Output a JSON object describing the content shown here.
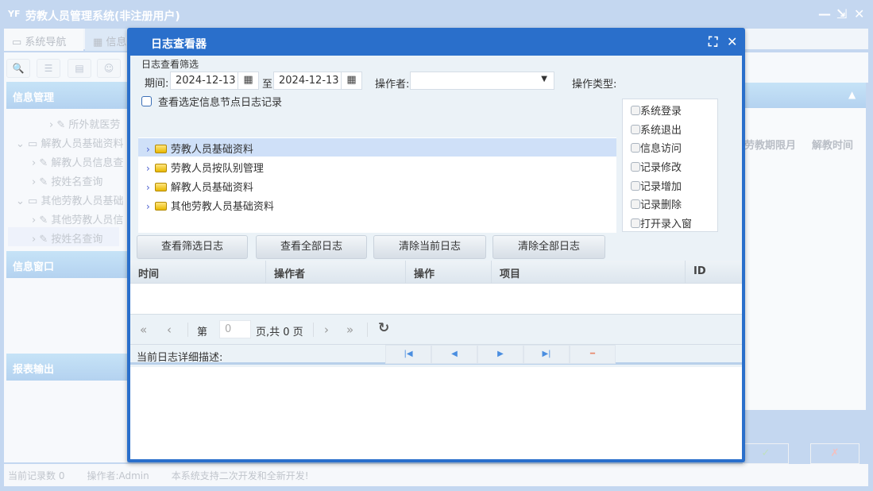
{
  "app": {
    "title": "劳教人员管理系统(非注册用户)",
    "logo": "YF",
    "min": "—",
    "restore": "⇲",
    "close": "✕"
  },
  "tabs": [
    {
      "label": "系统导航"
    },
    {
      "label": "信息"
    }
  ],
  "left": {
    "headers": [
      "信息管理",
      "信息窗口",
      "报表输出"
    ],
    "tree": [
      "所外就医劳",
      "解教人员基础资料",
      "解教人员信息查",
      "按姓名查询",
      "其他劳教人员基础",
      "其他劳教人员信",
      "按姓名查询"
    ]
  },
  "bg_columns": [
    "劳教期限月",
    "解教时间"
  ],
  "status": {
    "records": "当前记录数 0",
    "operator": "操作者:Admin",
    "note": "本系统支持二次开发和全新开发!"
  },
  "bg_buttons": {
    "ok": "✓",
    "cancel": "✗"
  },
  "dialog": {
    "title": "日志查看器",
    "filter_label": "日志查看筛选",
    "period_label": "期间:",
    "date_from": "2024-12-13",
    "to_label": "至",
    "date_to": "2024-12-13",
    "operator_label": "操作者:",
    "operator_value": "",
    "optype_label": "操作类型:",
    "node_check_label": "查看选定信息节点日志记录",
    "tree": [
      "劳教人员基础资料",
      "劳教人员按队别管理",
      "解教人员基础资料",
      "其他劳教人员基础资料"
    ],
    "op_types": [
      "系统登录",
      "系统退出",
      "信息访问",
      "记录修改",
      "记录增加",
      "记录删除",
      "打开录入窗"
    ],
    "buttons": [
      "查看筛选日志",
      "查看全部日志",
      "清除当前日志",
      "清除全部日志"
    ],
    "columns": [
      "时间",
      "操作者",
      "操作",
      "项目",
      "ID"
    ],
    "pager": {
      "page_prefix": "第",
      "page_value": "0",
      "page_suffix": "页,共 0 页"
    },
    "detail_label": "当前日志详细描述:"
  }
}
